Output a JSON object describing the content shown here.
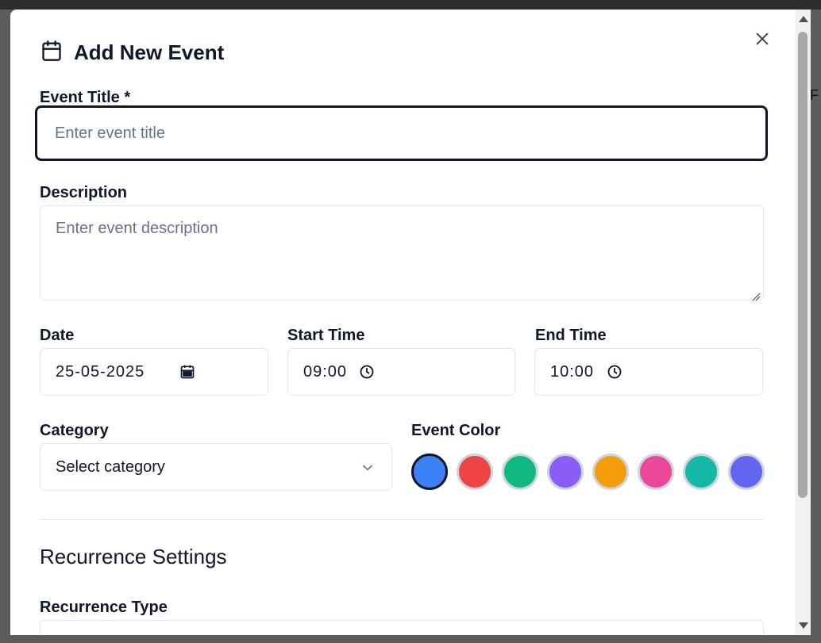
{
  "modal": {
    "title": "Add New Event",
    "title_icon": "calendar-icon",
    "close_icon": "close-icon"
  },
  "form": {
    "event_title": {
      "label": "Event Title *",
      "placeholder": "Enter event title",
      "value": ""
    },
    "description": {
      "label": "Description",
      "placeholder": "Enter event description",
      "value": ""
    },
    "date": {
      "label": "Date",
      "value": "25-05-2025",
      "icon": "calendar-icon"
    },
    "start_time": {
      "label": "Start Time",
      "value": "09:00",
      "icon": "clock-icon"
    },
    "end_time": {
      "label": "End Time",
      "value": "10:00",
      "icon": "clock-icon"
    },
    "category": {
      "label": "Category",
      "selected": "Select category",
      "icon": "chevron-down-icon"
    },
    "event_color": {
      "label": "Event Color",
      "selected_index": 0,
      "options": [
        "#3b82f6",
        "#ef4444",
        "#10b981",
        "#8b5cf6",
        "#f59e0b",
        "#ec4899",
        "#14b8a6",
        "#6366f1"
      ]
    }
  },
  "recurrence": {
    "section_title": "Recurrence Settings",
    "type_label": "Recurrence Type"
  },
  "background": {
    "partial_text": "F"
  }
}
